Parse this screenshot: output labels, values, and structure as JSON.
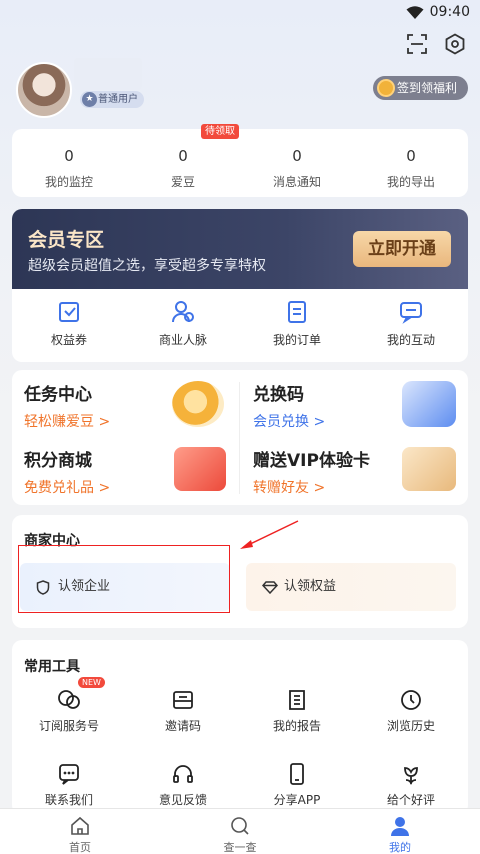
{
  "status_bar": {
    "time": "09:40"
  },
  "profile": {
    "badge": "普通用户",
    "signin_label": "签到领福利"
  },
  "stats": [
    {
      "value": "0",
      "label": "我的监控"
    },
    {
      "value": "0",
      "label": "爱豆"
    },
    {
      "value": "0",
      "label": "消息通知"
    },
    {
      "value": "0",
      "label": "我的导出"
    }
  ],
  "pending_tag": "待领取",
  "vip": {
    "title": "会员专区",
    "subtitle": "超级会员超值之选，享受超多专享特权",
    "button": "立即开通",
    "items": [
      {
        "label": "权益券",
        "icon": "coupon-icon"
      },
      {
        "label": "商业人脉",
        "icon": "network-icon"
      },
      {
        "label": "我的订单",
        "icon": "order-icon"
      },
      {
        "label": "我的互动",
        "icon": "chat-icon"
      }
    ]
  },
  "tasks": [
    {
      "title": "任务中心",
      "sub": "轻松赚爱豆 >"
    },
    {
      "title": "兑换码",
      "sub": "会员兑换 >"
    },
    {
      "title": "积分商城",
      "sub": "免费兑礼品 >"
    },
    {
      "title": "赠送VIP体验卡",
      "sub": "转赠好友 >"
    }
  ],
  "merchant": {
    "title": "商家中心",
    "claim_company": "认领企业",
    "claim_rights": "认领权益"
  },
  "tools": {
    "title": "常用工具",
    "new_tag": "NEW",
    "items": [
      {
        "label": "订阅服务号",
        "icon": "subscribe-icon"
      },
      {
        "label": "邀请码",
        "icon": "invite-icon"
      },
      {
        "label": "我的报告",
        "icon": "report-icon"
      },
      {
        "label": "浏览历史",
        "icon": "history-icon"
      },
      {
        "label": "联系我们",
        "icon": "contact-icon"
      },
      {
        "label": "意见反馈",
        "icon": "headset-icon"
      },
      {
        "label": "分享APP",
        "icon": "phone-icon"
      },
      {
        "label": "给个好评",
        "icon": "flower-icon"
      }
    ]
  },
  "tabs": [
    {
      "label": "首页",
      "active": false
    },
    {
      "label": "查一查",
      "active": false
    },
    {
      "label": "我的",
      "active": true
    }
  ],
  "colors": {
    "accent": "#3f73e8",
    "orange": "#f0742b",
    "vip_gold": "#e9b77d",
    "highlight_box": "#e22222"
  }
}
